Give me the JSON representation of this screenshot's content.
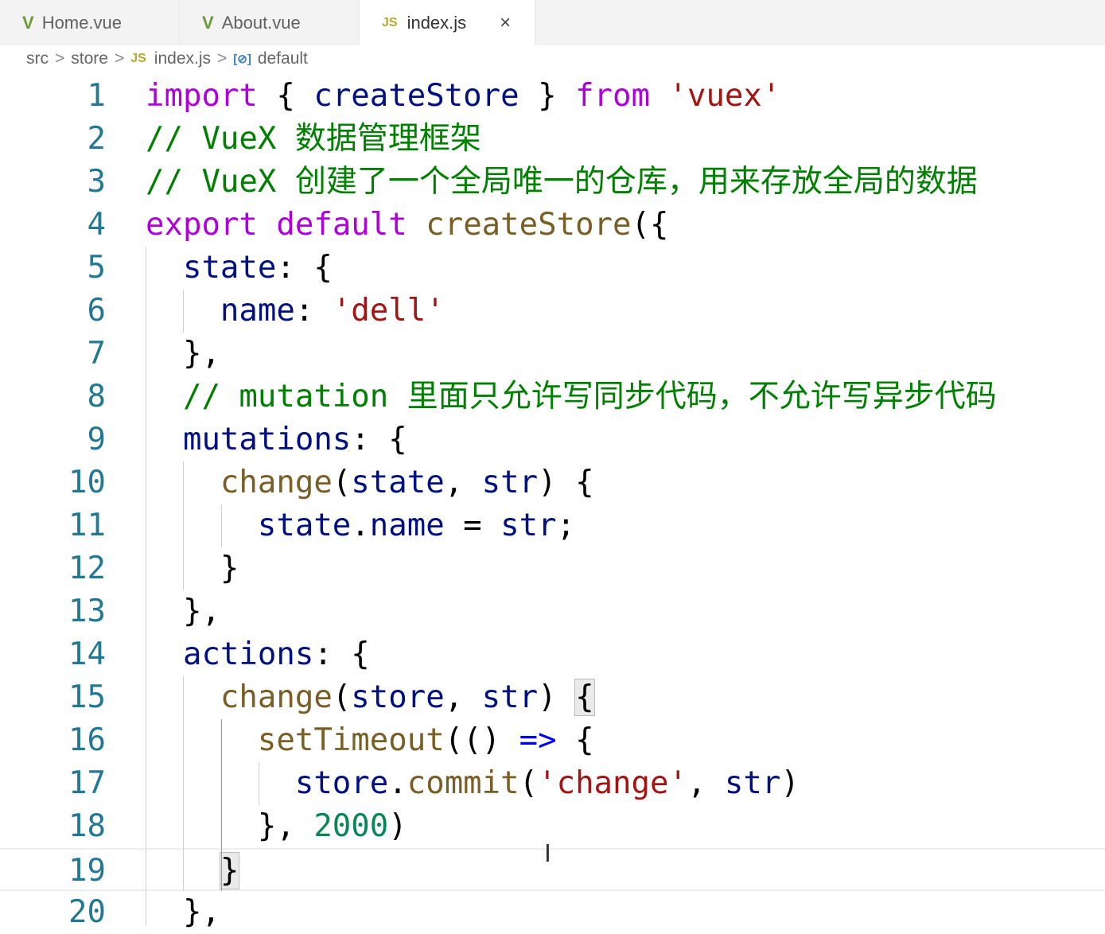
{
  "tabs": [
    {
      "label": "Home.vue",
      "icon": "vue-icon"
    },
    {
      "label": "About.vue",
      "icon": "vue-icon"
    },
    {
      "label": "index.js",
      "icon": "js-icon",
      "active": true
    }
  ],
  "tab_icons": {
    "vue": "V",
    "js": "JS",
    "close": "×"
  },
  "breadcrumb": {
    "items": [
      "src",
      "store",
      "index.js",
      "default"
    ],
    "sep": ">",
    "symbol": "[⊘]"
  },
  "cursor_glyph": "I",
  "lines": [
    [
      [
        "import",
        "k"
      ],
      [
        " { ",
        "p"
      ],
      [
        "createStore",
        "v"
      ],
      [
        " } ",
        "p"
      ],
      [
        "from",
        "k"
      ],
      [
        " ",
        "p"
      ],
      [
        "'vuex'",
        "s"
      ]
    ],
    [
      [
        "// VueX 数据管理框架",
        "c"
      ]
    ],
    [
      [
        "// VueX 创建了一个全局唯一的仓库，用来存放全局的数据",
        "c"
      ]
    ],
    [
      [
        "export",
        "k"
      ],
      [
        " ",
        "p"
      ],
      [
        "default",
        "k"
      ],
      [
        " ",
        "p"
      ],
      [
        "createStore",
        "f"
      ],
      [
        "({",
        "p"
      ]
    ],
    [
      [
        "  ",
        "p"
      ],
      [
        "state",
        "v"
      ],
      [
        ": {",
        "p"
      ]
    ],
    [
      [
        "    ",
        "p"
      ],
      [
        "name",
        "v"
      ],
      [
        ": ",
        "p"
      ],
      [
        "'dell'",
        "s"
      ]
    ],
    [
      [
        "  },",
        "p"
      ]
    ],
    [
      [
        "  // mutation 里面只允许写同步代码，不允许写异步代码",
        "c"
      ]
    ],
    [
      [
        "  ",
        "p"
      ],
      [
        "mutations",
        "v"
      ],
      [
        ": {",
        "p"
      ]
    ],
    [
      [
        "    ",
        "p"
      ],
      [
        "change",
        "f"
      ],
      [
        "(",
        "p"
      ],
      [
        "state",
        "v"
      ],
      [
        ", ",
        "p"
      ],
      [
        "str",
        "v"
      ],
      [
        ") {",
        "p"
      ]
    ],
    [
      [
        "      ",
        "p"
      ],
      [
        "state",
        "v"
      ],
      [
        ".",
        "p"
      ],
      [
        "name",
        "v"
      ],
      [
        " = ",
        "p"
      ],
      [
        "str",
        "v"
      ],
      [
        ";",
        "p"
      ]
    ],
    [
      [
        "    }",
        "p"
      ]
    ],
    [
      [
        "  },",
        "p"
      ]
    ],
    [
      [
        "  ",
        "p"
      ],
      [
        "actions",
        "v"
      ],
      [
        ": {",
        "p"
      ]
    ],
    [
      [
        "    ",
        "p"
      ],
      [
        "change",
        "f"
      ],
      [
        "(",
        "p"
      ],
      [
        "store",
        "v"
      ],
      [
        ", ",
        "p"
      ],
      [
        "str",
        "v"
      ],
      [
        ") ",
        "p"
      ],
      [
        "{",
        "p bm"
      ]
    ],
    [
      [
        "      ",
        "p"
      ],
      [
        "setTimeout",
        "f"
      ],
      [
        "(() ",
        "p"
      ],
      [
        "=>",
        "o"
      ],
      [
        " {",
        "p"
      ]
    ],
    [
      [
        "        ",
        "p"
      ],
      [
        "store",
        "v"
      ],
      [
        ".",
        "p"
      ],
      [
        "commit",
        "f"
      ],
      [
        "(",
        "p"
      ],
      [
        "'change'",
        "s"
      ],
      [
        ", ",
        "p"
      ],
      [
        "str",
        "v"
      ],
      [
        ")",
        "p"
      ]
    ],
    [
      [
        "      }, ",
        "p"
      ],
      [
        "2000",
        "n"
      ],
      [
        ")",
        "p"
      ]
    ],
    [
      [
        "    ",
        "p"
      ],
      [
        "}",
        "p bm"
      ]
    ],
    [
      [
        "  },",
        "p"
      ]
    ]
  ]
}
